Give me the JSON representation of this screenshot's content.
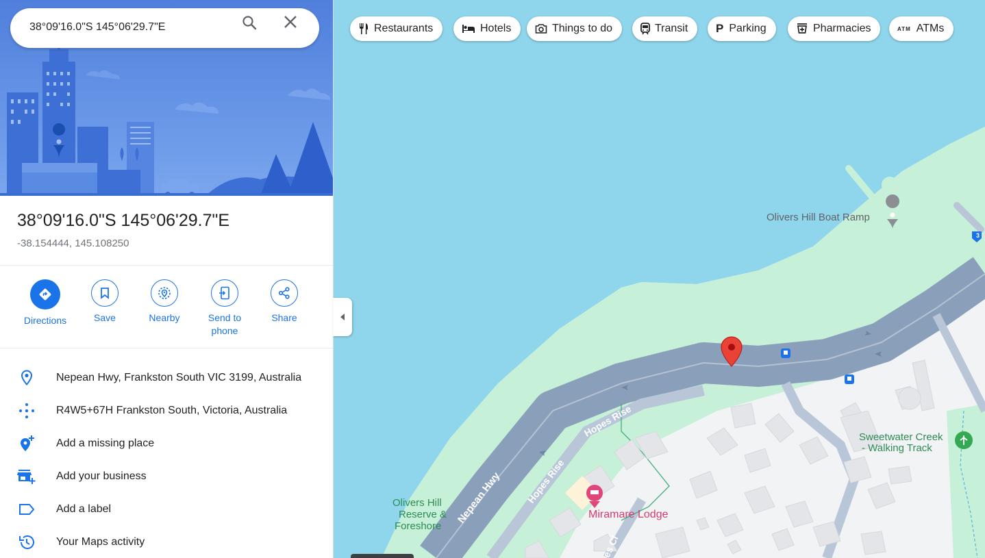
{
  "search": {
    "value": "38°09'16.0\"S 145°06'29.7\"E"
  },
  "place": {
    "title": "38°09'16.0\"S 145°06'29.7\"E",
    "decimal": "-38.154444, 145.108250"
  },
  "actions": [
    {
      "label": "Directions",
      "icon": "directions-icon"
    },
    {
      "label": "Save",
      "icon": "bookmark-icon"
    },
    {
      "label": "Nearby",
      "icon": "nearby-icon"
    },
    {
      "label": "Send to phone",
      "icon": "send-to-phone-icon"
    },
    {
      "label": "Share",
      "icon": "share-icon"
    }
  ],
  "info_rows": [
    {
      "text": "Nepean Hwy, Frankston South VIC 3199, Australia",
      "icon": "location-pin-icon"
    },
    {
      "text": "R4W5+67H Frankston South, Victoria, Australia",
      "icon": "plus-code-icon"
    },
    {
      "text": "Add a missing place",
      "icon": "add-place-icon"
    },
    {
      "text": "Add your business",
      "icon": "add-business-icon"
    },
    {
      "text": "Add a label",
      "icon": "label-icon"
    },
    {
      "text": "Your Maps activity",
      "icon": "history-icon"
    }
  ],
  "chips": [
    {
      "label": "Restaurants",
      "icon": "restaurant-icon"
    },
    {
      "label": "Hotels",
      "icon": "hotel-icon"
    },
    {
      "label": "Things to do",
      "icon": "camera-icon"
    },
    {
      "label": "Transit",
      "icon": "transit-icon"
    },
    {
      "label": "Parking",
      "icon": "parking-icon"
    },
    {
      "label": "Pharmacies",
      "icon": "pharmacy-icon"
    },
    {
      "label": "ATMs",
      "icon": "atm-icon"
    }
  ],
  "map": {
    "labels": {
      "boat_ramp": "Olivers Hill Boat Ramp",
      "walking_track_1": "Sweetwater Creek",
      "walking_track_2": "- Walking Track",
      "reserve_1": "Olivers Hill",
      "reserve_2": "Reserve &",
      "reserve_3": "Foreshore",
      "lodge": "Miramare Lodge",
      "road_nepean": "Nepean Hwy",
      "road_hopes_1": "Hopes Rise",
      "road_hopes_2": "Hopes Rise",
      "road_cl": "es Cl",
      "route_shield": "3"
    },
    "colors": {
      "water": "#8fd6ec",
      "park": "#c6f0d7",
      "highway": "#8a9fb9",
      "marker": "#ea4335",
      "accent": "#1a73e8"
    }
  }
}
